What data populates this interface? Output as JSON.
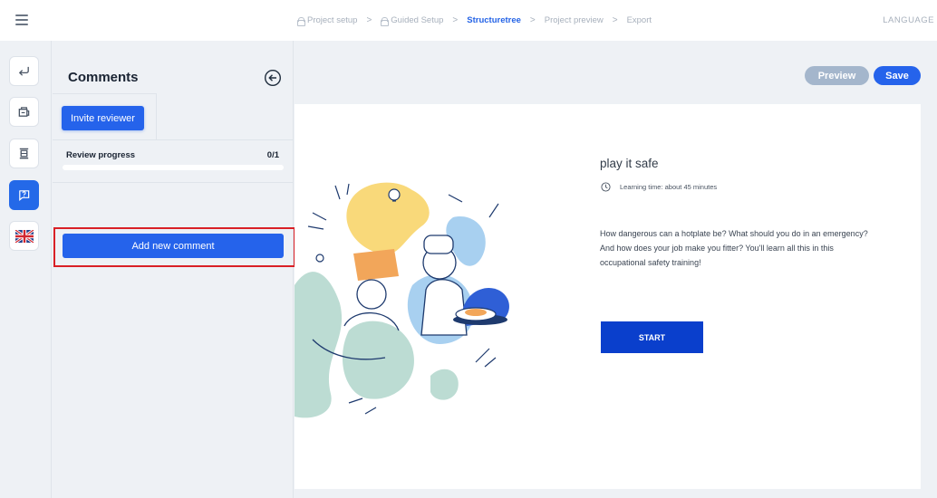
{
  "topbar": {
    "breadcrumbs": [
      {
        "label": "Project setup",
        "locked": true,
        "active": false
      },
      {
        "label": "Guided Setup",
        "locked": true,
        "active": false
      },
      {
        "label": "Structuretree",
        "locked": false,
        "active": true
      },
      {
        "label": "Project preview",
        "locked": false,
        "active": false
      },
      {
        "label": "Export",
        "locked": false,
        "active": false
      }
    ],
    "separator": ">",
    "language_label": "LANGUAGE"
  },
  "rail": {
    "items": [
      {
        "icon": "return-arrow-icon",
        "active": false
      },
      {
        "icon": "package-icon",
        "active": false
      },
      {
        "icon": "structure-icon",
        "active": false
      },
      {
        "icon": "comment-question-icon",
        "active": true
      },
      {
        "icon": "uk-flag-icon",
        "active": false
      }
    ]
  },
  "comments_panel": {
    "title": "Comments",
    "invite_label": "Invite reviewer",
    "progress_label": "Review progress",
    "progress_count": "0/1",
    "progress_value": 0,
    "add_comment_label": "Add new comment"
  },
  "toolbar": {
    "preview_label": "Preview",
    "save_label": "Save"
  },
  "course": {
    "title": "play it safe",
    "learning_time": "Learning time: about 45 minutes",
    "description": "How dangerous can a hotplate be? What should you do in an emergency? And how does your job make you fitter? You'll learn all this in this occupational safety training!",
    "start_label": "START"
  },
  "colors": {
    "primary": "#2563eb",
    "start_button": "#0a3fcc",
    "preview_button": "#a4b6cc",
    "highlight": "#d92026"
  }
}
